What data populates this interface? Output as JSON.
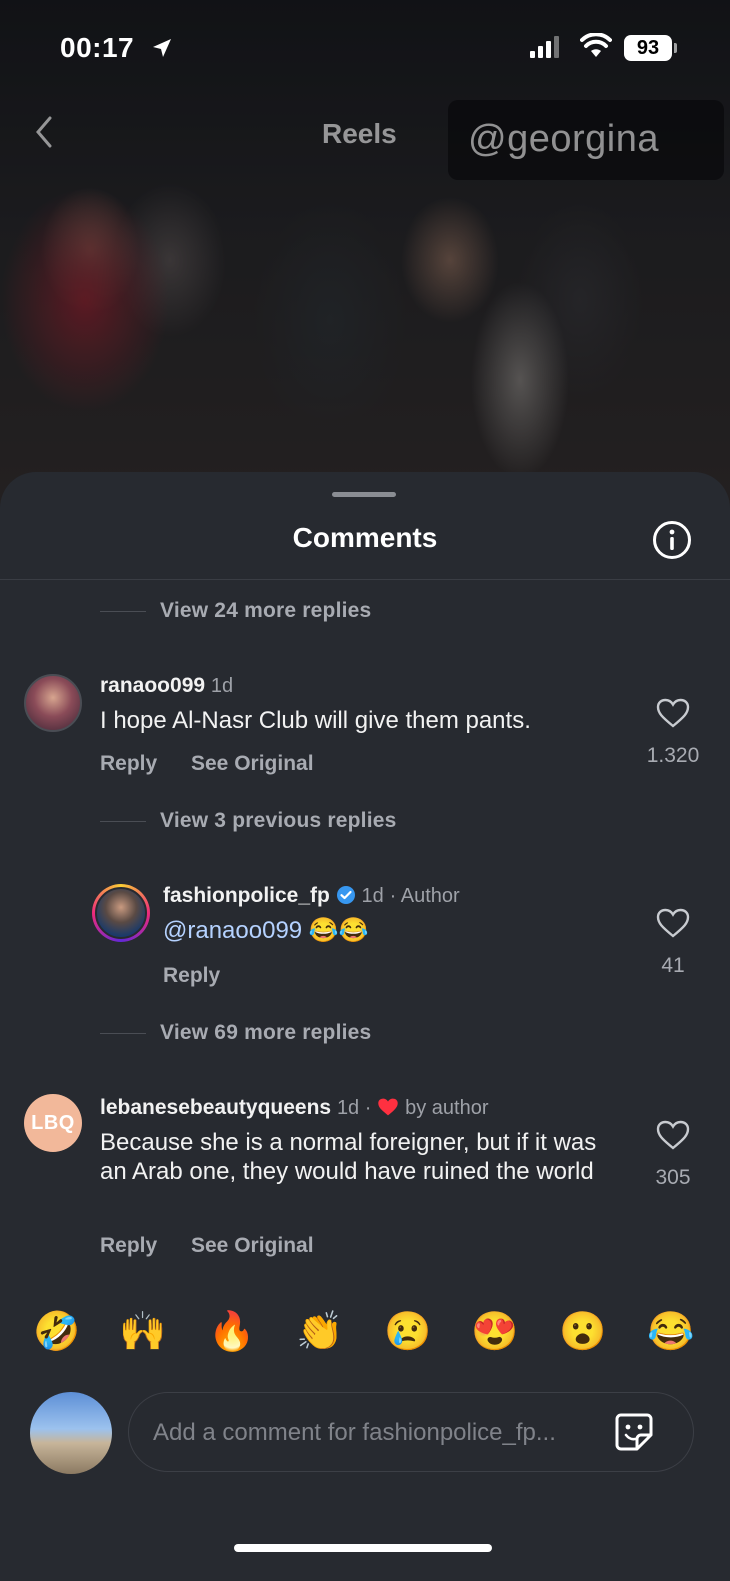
{
  "status_bar": {
    "time": "00:17",
    "battery": "93"
  },
  "header": {
    "title": "Reels",
    "watermark": "@georgina"
  },
  "comments_sheet": {
    "title": "Comments",
    "threads": [
      {
        "view_replies": "View 24 more replies"
      },
      {
        "username": "ranaoo099",
        "time": "1d",
        "text": "I hope Al-Nasr Club will give them pants.",
        "reply_label": "Reply",
        "see_original_label": "See Original",
        "likes": "1.320"
      },
      {
        "view_replies": "View 3 previous replies"
      },
      {
        "username": "fashionpolice_fp",
        "time": "1d",
        "role": "· Author",
        "mention": "@ranaoo099",
        "emojis": "😂😂",
        "reply_label": "Reply",
        "likes": "41"
      },
      {
        "view_replies": "View 69 more replies"
      },
      {
        "username": "lebanesebeautyqueens",
        "time": "1d ·",
        "liked_by": "by author",
        "avatar_text": "LBQ",
        "text": "Because she is a normal foreigner, but if it was an Arab one, they would have ruined the world",
        "reply_label": "Reply",
        "see_original_label": "See Original",
        "likes": "305"
      }
    ]
  },
  "emoji_bar": [
    "🤣",
    "🙌",
    "🔥",
    "👏",
    "😢",
    "😍",
    "😮",
    "😂"
  ],
  "composer": {
    "placeholder": "Add a comment for fashionpolice_fp..."
  },
  "colors": {
    "sheet_bg": "#272a30",
    "mention": "#b5d2ff",
    "verified": "#3797f0",
    "heart_red": "#ff3040"
  }
}
